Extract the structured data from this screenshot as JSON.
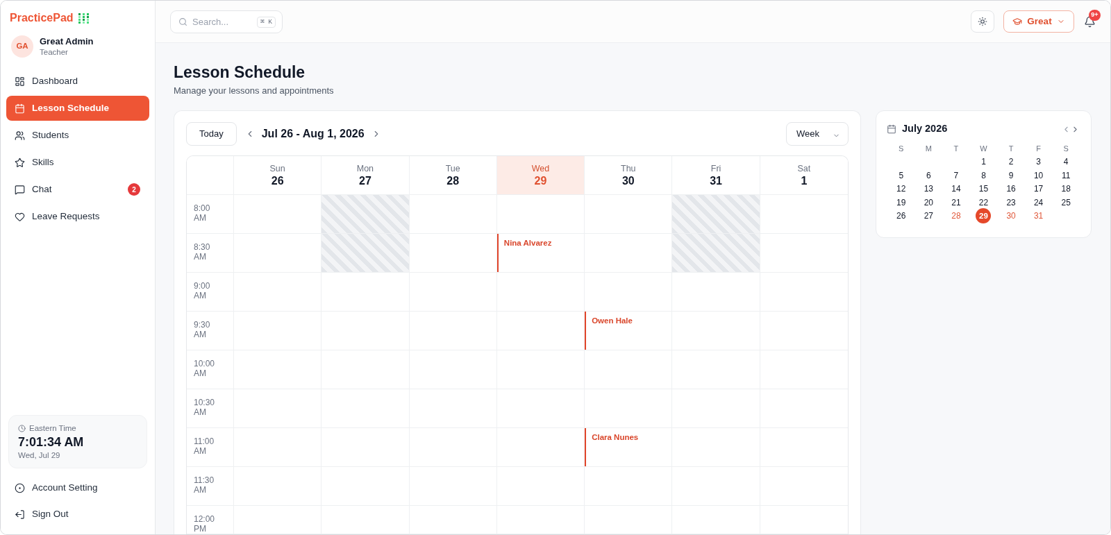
{
  "brand": {
    "name": "PracticePad"
  },
  "user": {
    "initials": "GA",
    "name": "Great Admin",
    "role": "Teacher"
  },
  "nav": [
    {
      "label": "Dashboard",
      "selected": false
    },
    {
      "label": "Lesson Schedule",
      "selected": true
    },
    {
      "label": "Students",
      "selected": false
    },
    {
      "label": "Skills",
      "selected": false
    },
    {
      "label": "Chat",
      "selected": false,
      "badge": "2"
    },
    {
      "label": "Leave Requests",
      "selected": false
    }
  ],
  "clock": {
    "zone": "Eastern Time",
    "time": "7:01:34 AM",
    "date": "Wed, Jul 29"
  },
  "account_nav": [
    "Account Setting",
    "Sign Out"
  ],
  "top_bar": {
    "search": {
      "placeholder": "Search...",
      "shortcut": "⌘ K"
    },
    "profile_button": {
      "label": "Great"
    },
    "notifications": {
      "badge": "9+"
    }
  },
  "page": {
    "title": "Lesson Schedule",
    "subtitle": "Manage your lessons and appointments"
  },
  "schedule": {
    "today_button": "Today",
    "range": "Jul 26 - Aug 1, 2026",
    "view": "Week",
    "days": [
      {
        "name": "Sun",
        "date": "26",
        "selected": false
      },
      {
        "name": "Mon",
        "date": "27",
        "selected": false
      },
      {
        "name": "Tue",
        "date": "28",
        "selected": false
      },
      {
        "name": "Wed",
        "date": "29",
        "selected": true
      },
      {
        "name": "Thu",
        "date": "30",
        "selected": false
      },
      {
        "name": "Fri",
        "date": "31",
        "selected": false
      },
      {
        "name": "Sat",
        "date": "1",
        "selected": false
      }
    ],
    "rows": [
      {
        "time": "8:00 AM",
        "cells": [
          {
            "blocked": false
          },
          {
            "blocked": true
          },
          {
            "blocked": false
          },
          {
            "blocked": false
          },
          {
            "blocked": false
          },
          {
            "blocked": true
          },
          {
            "blocked": false
          }
        ]
      },
      {
        "time": "8:30 AM",
        "cells": [
          {
            "blocked": false
          },
          {
            "blocked": true
          },
          {
            "blocked": false
          },
          {
            "blocked": false,
            "lesson": "Nina Alvarez"
          },
          {
            "blocked": false
          },
          {
            "blocked": true
          },
          {
            "blocked": false
          }
        ]
      },
      {
        "time": "9:00 AM",
        "cells": [
          {
            "blocked": false
          },
          {
            "blocked": false
          },
          {
            "blocked": false
          },
          {
            "blocked": false
          },
          {
            "blocked": false
          },
          {
            "blocked": false
          },
          {
            "blocked": false
          }
        ]
      },
      {
        "time": "9:30 AM",
        "cells": [
          {
            "blocked": false
          },
          {
            "blocked": false
          },
          {
            "blocked": false
          },
          {
            "blocked": false
          },
          {
            "blocked": false,
            "lesson": "Owen Hale"
          },
          {
            "blocked": false
          },
          {
            "blocked": false
          }
        ]
      },
      {
        "time": "10:00 AM",
        "cells": [
          {
            "blocked": false
          },
          {
            "blocked": false
          },
          {
            "blocked": false
          },
          {
            "blocked": false
          },
          {
            "blocked": false
          },
          {
            "blocked": false
          },
          {
            "blocked": false
          }
        ]
      },
      {
        "time": "10:30 AM",
        "cells": [
          {
            "blocked": false
          },
          {
            "blocked": false
          },
          {
            "blocked": false
          },
          {
            "blocked": false
          },
          {
            "blocked": false
          },
          {
            "blocked": false
          },
          {
            "blocked": false
          }
        ]
      },
      {
        "time": "11:00 AM",
        "cells": [
          {
            "blocked": false
          },
          {
            "blocked": false
          },
          {
            "blocked": false
          },
          {
            "blocked": false
          },
          {
            "blocked": false,
            "lesson": "Clara Nunes"
          },
          {
            "blocked": false
          },
          {
            "blocked": false
          }
        ]
      },
      {
        "time": "11:30 AM",
        "cells": [
          {
            "blocked": false
          },
          {
            "blocked": false
          },
          {
            "blocked": false
          },
          {
            "blocked": false
          },
          {
            "blocked": false
          },
          {
            "blocked": false
          },
          {
            "blocked": false
          }
        ]
      },
      {
        "time": "12:00 PM",
        "cells": [
          {
            "blocked": false
          },
          {
            "blocked": false
          },
          {
            "blocked": false
          },
          {
            "blocked": false
          },
          {
            "blocked": false
          },
          {
            "blocked": false
          },
          {
            "blocked": false
          }
        ]
      }
    ]
  },
  "mini_calendar": {
    "title": "July 2026",
    "weekdays": [
      "S",
      "M",
      "T",
      "W",
      "T",
      "F",
      "S"
    ],
    "weeks": [
      {
        "days": [
          {
            "day": "1",
            "selected": false,
            "highlighted": false
          },
          {
            "day": "2",
            "selected": false,
            "highlighted": false
          },
          {
            "day": "3",
            "selected": false,
            "highlighted": false
          },
          {
            "day": "4",
            "selected": false,
            "highlighted": false
          }
        ]
      },
      {
        "days": [
          {
            "day": "5",
            "selected": false,
            "highlighted": false
          },
          {
            "day": "6",
            "selected": false,
            "highlighted": false
          },
          {
            "day": "7",
            "selected": false,
            "highlighted": false
          },
          {
            "day": "8",
            "selected": false,
            "highlighted": false
          },
          {
            "day": "9",
            "selected": false,
            "highlighted": false
          },
          {
            "day": "10",
            "selected": false,
            "highlighted": false
          },
          {
            "day": "11",
            "selected": false,
            "highlighted": false
          }
        ]
      },
      {
        "days": [
          {
            "day": "12",
            "selected": false,
            "highlighted": false
          },
          {
            "day": "13",
            "selected": false,
            "highlighted": false
          },
          {
            "day": "14",
            "selected": false,
            "highlighted": false
          },
          {
            "day": "15",
            "selected": false,
            "highlighted": false
          },
          {
            "day": "16",
            "selected": false,
            "highlighted": false
          },
          {
            "day": "17",
            "selected": false,
            "highlighted": false
          },
          {
            "day": "18",
            "selected": false,
            "highlighted": false
          }
        ]
      },
      {
        "days": [
          {
            "day": "19",
            "selected": false,
            "highlighted": false
          },
          {
            "day": "20",
            "selected": false,
            "highlighted": false
          },
          {
            "day": "21",
            "selected": false,
            "highlighted": false
          },
          {
            "day": "22",
            "selected": false,
            "highlighted": false
          },
          {
            "day": "23",
            "selected": false,
            "highlighted": false
          },
          {
            "day": "24",
            "selected": false,
            "highlighted": false
          },
          {
            "day": "25",
            "selected": false,
            "highlighted": false
          }
        ]
      },
      {
        "days": [
          {
            "day": "26",
            "selected": false,
            "highlighted": false
          },
          {
            "day": "27",
            "selected": false,
            "highlighted": false
          },
          {
            "day": "28",
            "selected": false,
            "highlighted": true
          },
          {
            "day": "29",
            "selected": true,
            "highlighted": false
          },
          {
            "day": "30",
            "selected": false,
            "highlighted": true
          },
          {
            "day": "31",
            "selected": false,
            "highlighted": true
          }
        ]
      }
    ]
  }
}
